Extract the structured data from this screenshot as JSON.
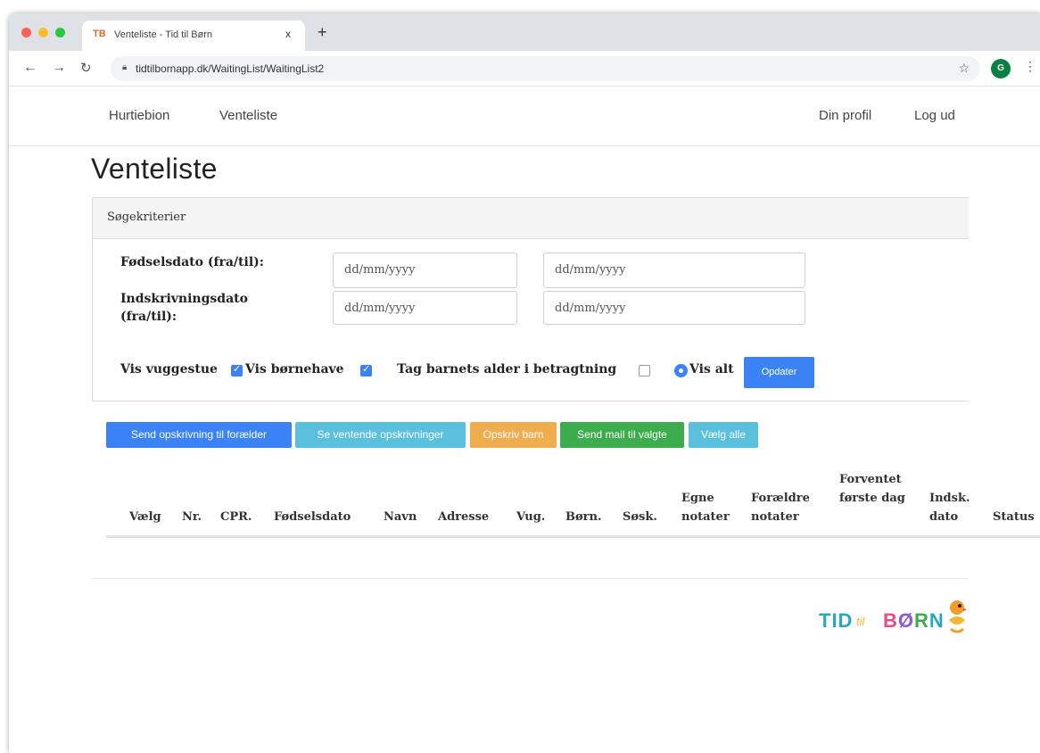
{
  "browser": {
    "tab_logo": "TB",
    "tab_title": "Venteliste - Tid til Børn",
    "tab_close": "x",
    "new_tab": "+",
    "url": "tidtilbornapp.dk/WaitingList/WaitingList2",
    "profile_initial": "G"
  },
  "nav": {
    "home": "Hurtiebion",
    "waitlist": "Venteliste",
    "profile": "Din profil",
    "logout": "Log ud"
  },
  "page": {
    "title": "Venteliste"
  },
  "search": {
    "header": "Søgekriterier",
    "birth_label": "Fødselsdato (fra/til):",
    "enroll_label": "Indskrivningsdato (fra/til):",
    "date_placeholder_1": "dd/mm/yyyy",
    "date_placeholder_2": "dd/mm/yyyy",
    "date_placeholder_3": "dd/mm/yyyy",
    "date_placeholder_4": "dd/mm/yyyy",
    "show_nursery": "Vis vuggestue",
    "show_kindergarten": "Vis børnehave",
    "consider_age": "Tag barnets alder i betragtning",
    "show_all": "Vis alt",
    "update_button": "Opdater"
  },
  "actions": {
    "send_to_parents": "Send opskrivning til forælder",
    "see_pending": "Se ventende opskrivninger",
    "create_child": "Opskriv barn",
    "send_mail": "Send mail til valgte",
    "select_all": "Vælg alle"
  },
  "table": {
    "columns": [
      "Vælg",
      "Nr.",
      "CPR.",
      "Fødselsdato",
      "Navn",
      "Adresse",
      "Vug.",
      "Børn.",
      "Søsk.",
      "Egne notater",
      "Forældre notater",
      "Forventet første dag",
      "Indsk. dato",
      "Status"
    ]
  },
  "logo": {
    "tid": "TID",
    "til": "til",
    "born": "BØRN"
  },
  "colors": {
    "primary": "#3b82f6",
    "info": "#5bc0de",
    "warning": "#f0ad4e",
    "success": "#3cac4c"
  }
}
